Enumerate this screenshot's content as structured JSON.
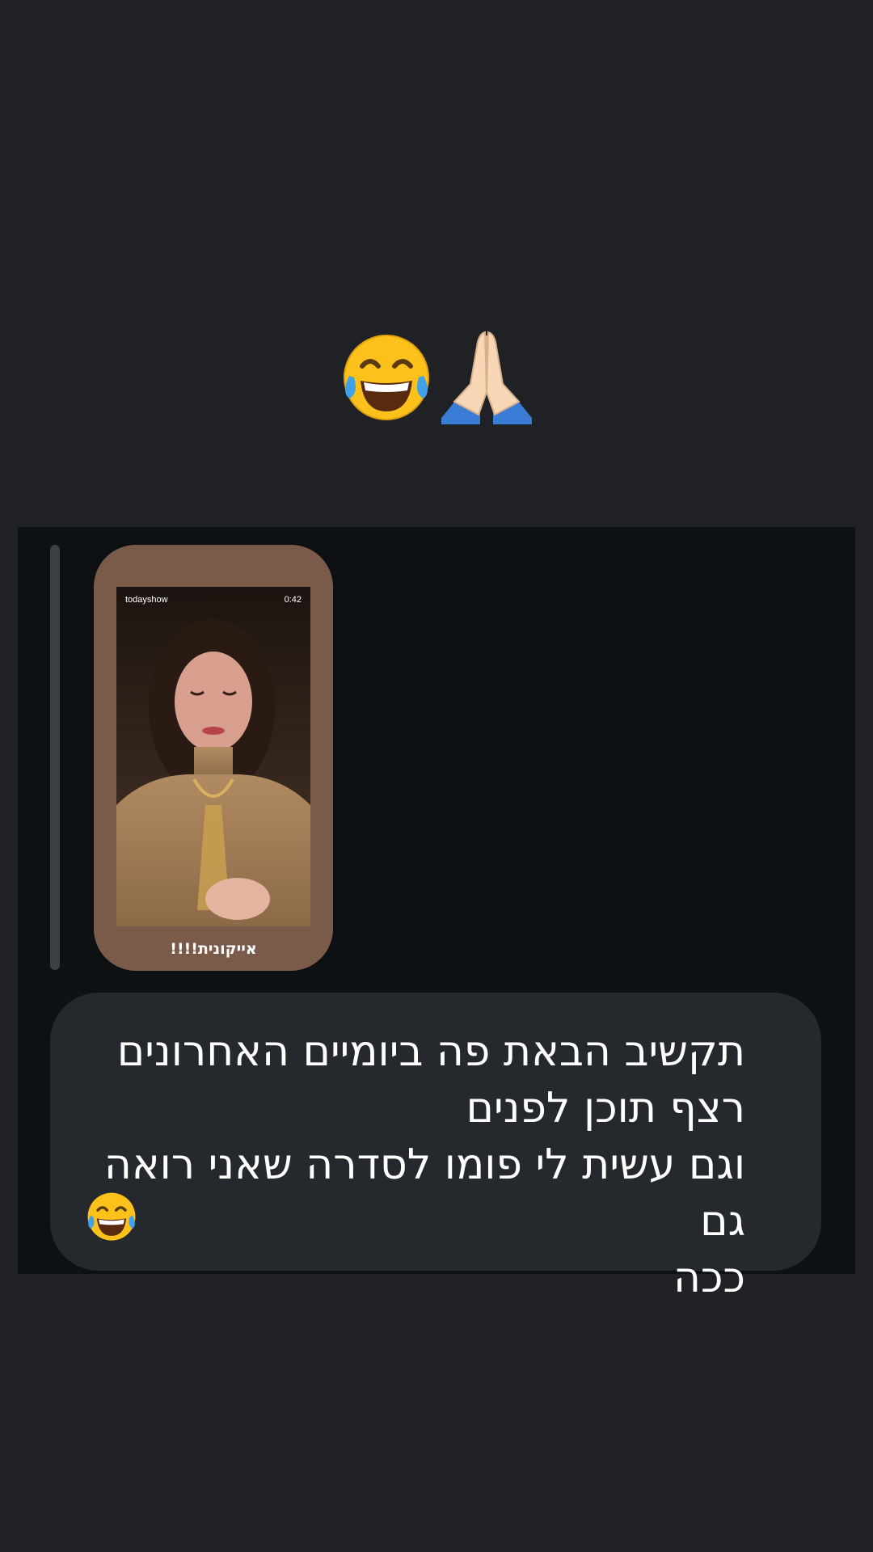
{
  "top_reaction": {
    "emoji_icons": [
      "joy-emoji-icon",
      "folded-hands-emoji-icon"
    ]
  },
  "reply": {
    "story": {
      "username": "todayshow",
      "duration": "0:42",
      "caption": "אייקונית!!!!"
    }
  },
  "message": {
    "lines": [
      "תקשיב הבאת פה ביומיים האחרונים",
      "רצף תוכן לפנים",
      "וגם עשית לי פומו לסדרה שאני רואה גם",
      "ככה"
    ],
    "trailing_emoji": "joy-emoji-icon"
  },
  "colors": {
    "background": "#1f2124",
    "panel": "#0d1114",
    "bubble": "#25282d",
    "story_card": "#7a5a48"
  }
}
